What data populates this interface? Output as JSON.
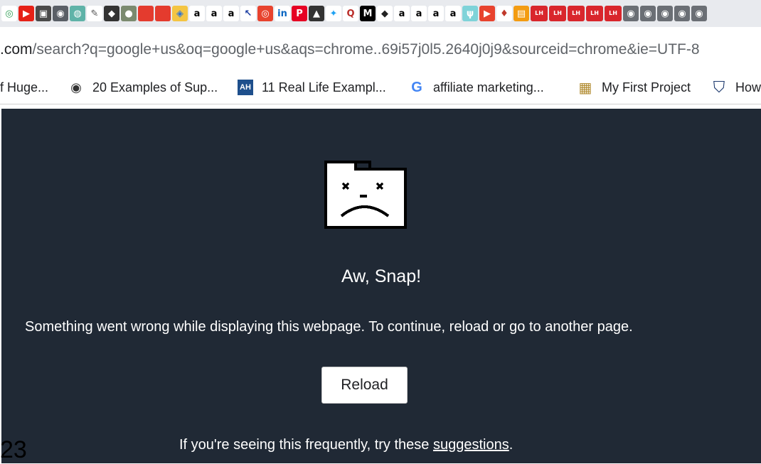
{
  "extensions": [
    {
      "name": "green-circle-extension-icon",
      "glyph": "◎",
      "bg": "#ffffff",
      "fg": "#2e9e55"
    },
    {
      "name": "youtube-extension-icon",
      "glyph": "▶",
      "bg": "#e62117",
      "fg": "#ffffff"
    },
    {
      "name": "box-extension-icon",
      "glyph": "▣",
      "bg": "#4a4a4a",
      "fg": "#ffffff"
    },
    {
      "name": "globe-extension-icon",
      "glyph": "◉",
      "bg": "#5a5f66",
      "fg": "#ffffff"
    },
    {
      "name": "teal-extension-icon",
      "glyph": "◍",
      "bg": "#5fb3a8",
      "fg": "#ffffff"
    },
    {
      "name": "sketch-extension-icon",
      "glyph": "✎",
      "bg": "#ffffff",
      "fg": "#555555"
    },
    {
      "name": "shield-extension-icon",
      "glyph": "◆",
      "bg": "#333333",
      "fg": "#ffffff"
    },
    {
      "name": "gray-dot-extension-icon",
      "glyph": "●",
      "bg": "#7b8a6f",
      "fg": "#ffffff"
    },
    {
      "name": "red-square-extension-icon",
      "glyph": " ",
      "bg": "#e43b2e",
      "fg": "#ffffff"
    },
    {
      "name": "red-square-2-extension-icon",
      "glyph": " ",
      "bg": "#e43b2e",
      "fg": "#ffffff"
    },
    {
      "name": "colorful-extension-icon",
      "glyph": "◈",
      "bg": "#f4c542",
      "fg": "#2b73d8"
    },
    {
      "name": "amazon-extension-icon",
      "glyph": "a",
      "bg": "#ffffff",
      "fg": "#000000"
    },
    {
      "name": "amazon-2-extension-icon",
      "glyph": "a",
      "bg": "#ffffff",
      "fg": "#000000"
    },
    {
      "name": "amazon-3-extension-icon",
      "glyph": "a",
      "bg": "#ffffff",
      "fg": "#000000"
    },
    {
      "name": "arrow-extension-icon",
      "glyph": "↖",
      "bg": "#ffffff",
      "fg": "#1d3fa3"
    },
    {
      "name": "orange-circle-extension-icon",
      "glyph": "◎",
      "bg": "#e8432e",
      "fg": "#ffffff"
    },
    {
      "name": "linkedin-extension-icon",
      "glyph": "in",
      "bg": "#ffffff",
      "fg": "#0a66c2"
    },
    {
      "name": "pinterest-extension-icon",
      "glyph": "P",
      "bg": "#e60023",
      "fg": "#ffffff"
    },
    {
      "name": "mountain-extension-icon",
      "glyph": "▲",
      "bg": "#333333",
      "fg": "#ffffff"
    },
    {
      "name": "twitter-extension-icon",
      "glyph": "✦",
      "bg": "#ffffff",
      "fg": "#1da1f2"
    },
    {
      "name": "quora-extension-icon",
      "glyph": "Q",
      "bg": "#ffffff",
      "fg": "#b92b27"
    },
    {
      "name": "medium-extension-icon",
      "glyph": "M",
      "bg": "#000000",
      "fg": "#ffffff"
    },
    {
      "name": "owl-extension-icon",
      "glyph": "◆",
      "bg": "#ffffff",
      "fg": "#222222"
    },
    {
      "name": "amazon-4-extension-icon",
      "glyph": "a",
      "bg": "#ffffff",
      "fg": "#000000"
    },
    {
      "name": "amazon-5-extension-icon",
      "glyph": "a",
      "bg": "#ffffff",
      "fg": "#000000"
    },
    {
      "name": "amazon-6-extension-icon",
      "glyph": "a",
      "bg": "#ffffff",
      "fg": "#000000"
    },
    {
      "name": "amazon-7-extension-icon",
      "glyph": "a",
      "bg": "#ffffff",
      "fg": "#000000"
    },
    {
      "name": "teal-shield-extension-icon",
      "glyph": "ψ",
      "bg": "#7fd3d9",
      "fg": "#ffffff"
    },
    {
      "name": "red-play-extension-icon",
      "glyph": "▶",
      "bg": "#e8432e",
      "fg": "#ffffff"
    },
    {
      "name": "flame-extension-icon",
      "glyph": "♦",
      "bg": "#ffffff",
      "fg": "#c0392b"
    },
    {
      "name": "orange-badge-extension-icon",
      "glyph": "▤",
      "bg": "#f39c12",
      "fg": "#ffffff"
    },
    {
      "name": "lh-extension-icon",
      "glyph": "LH",
      "bg": "#d9262c",
      "fg": "#ffffff",
      "wide": true
    },
    {
      "name": "lh-2-extension-icon",
      "glyph": "LH",
      "bg": "#d9262c",
      "fg": "#ffffff",
      "wide": true
    },
    {
      "name": "lh-3-extension-icon",
      "glyph": "LH",
      "bg": "#d9262c",
      "fg": "#ffffff",
      "wide": true
    },
    {
      "name": "lh-4-extension-icon",
      "glyph": "LH",
      "bg": "#d9262c",
      "fg": "#ffffff",
      "wide": true
    },
    {
      "name": "lh-5-extension-icon",
      "glyph": "LH",
      "bg": "#d9262c",
      "fg": "#ffffff",
      "wide": true
    },
    {
      "name": "gray-circle-extension-icon",
      "glyph": "◉",
      "bg": "#6b6f75",
      "fg": "#ffffff"
    },
    {
      "name": "gray-circle-2-extension-icon",
      "glyph": "◉",
      "bg": "#6b6f75",
      "fg": "#ffffff"
    },
    {
      "name": "gray-circle-3-extension-icon",
      "glyph": "◉",
      "bg": "#6b6f75",
      "fg": "#ffffff"
    },
    {
      "name": "gray-circle-4-extension-icon",
      "glyph": "◉",
      "bg": "#6b6f75",
      "fg": "#ffffff"
    },
    {
      "name": "gray-circle-5-extension-icon",
      "glyph": "◉",
      "bg": "#6b6f75",
      "fg": "#ffffff"
    }
  ],
  "url": {
    "domain": ".com",
    "path": "/search?q=google+us&oq=google+us&aqs=chrome..69i57j0l5.2640j0j9&sourceid=chrome&ie=UTF-8"
  },
  "bookmarks": [
    {
      "label": "f Huge...",
      "icon": "none"
    },
    {
      "label": "20 Examples of Sup...",
      "icon": "globe-icon",
      "glyph": "◉",
      "fg": "#333333",
      "bg": "transparent"
    },
    {
      "label": "11 Real Life Exampl...",
      "icon": "ah-icon",
      "glyph": "AH",
      "fg": "#ffffff",
      "bg": "#1e4f8c"
    },
    {
      "label": "affiliate marketing...",
      "icon": "google-icon",
      "glyph": "G",
      "fg": "#4285f4",
      "bg": "transparent"
    },
    {
      "label": "My First Project",
      "icon": "project-icon",
      "glyph": "▦",
      "fg": "#b08a2e",
      "bg": "transparent"
    },
    {
      "label": "How",
      "icon": "shield-icon",
      "glyph": "⛉",
      "fg": "#1e3a6e",
      "bg": "transparent"
    }
  ],
  "error": {
    "title": "Aw, Snap!",
    "message": "Something went wrong while displaying this webpage. To continue, reload or go to another page.",
    "reload_label": "Reload",
    "hint_prefix": "If you're seeing this frequently, try these ",
    "hint_link": "suggestions",
    "hint_suffix": "."
  },
  "corner_number": "23",
  "colors": {
    "page_bg": "#202935",
    "text": "#ffffff"
  }
}
